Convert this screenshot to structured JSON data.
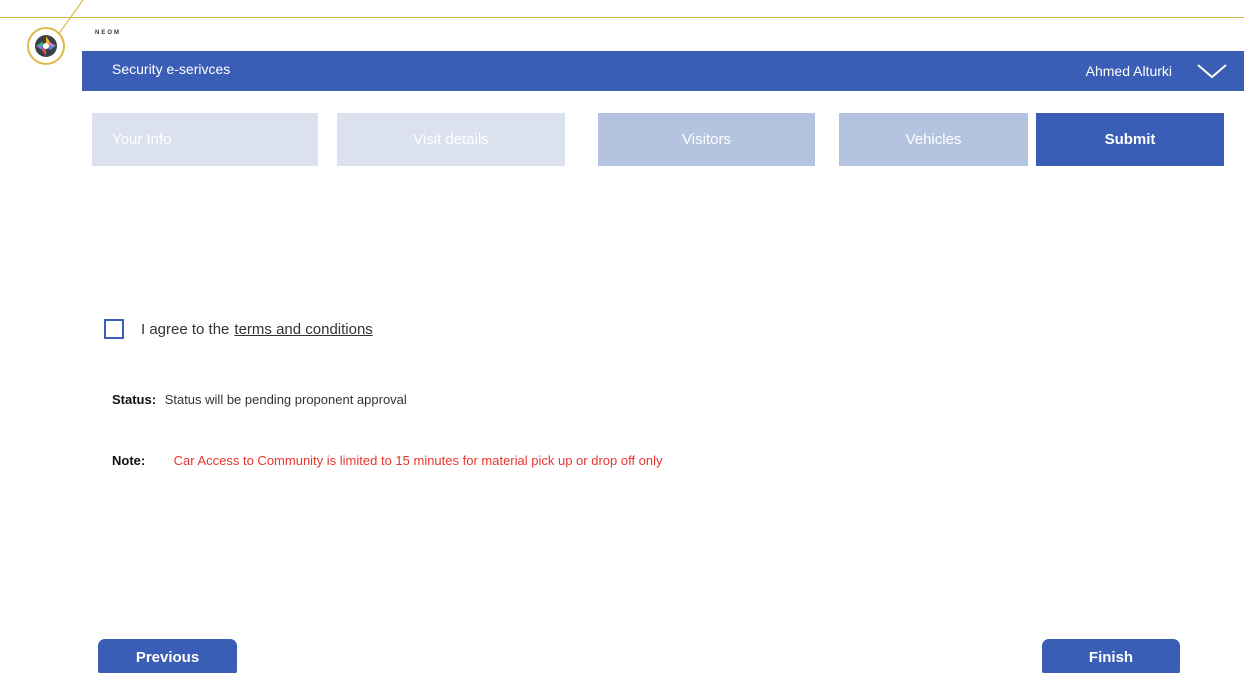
{
  "brand": {
    "name": "NEOM"
  },
  "header": {
    "title": "Security e-serivces",
    "user_name": "Ahmed Alturki",
    "color": "#3a5eb5"
  },
  "tabs": [
    {
      "label": "Your Info",
      "state": "completed"
    },
    {
      "label": "Visit details",
      "state": "completed"
    },
    {
      "label": "Visitors",
      "state": "completed"
    },
    {
      "label": "Vehicles",
      "state": "completed"
    },
    {
      "label": "Submit",
      "state": "active"
    }
  ],
  "agreement": {
    "prefix": "I agree to the",
    "link_text": "terms and conditions",
    "checked": false
  },
  "status": {
    "label": "Status:",
    "value": "Status will be pending proponent approval"
  },
  "note": {
    "label": "Note:",
    "value": "Car Access to Community is limited to 15 minutes for material pick up or drop off only",
    "color": "#e8362f"
  },
  "buttons": {
    "previous": "Previous",
    "finish": "Finish"
  },
  "icons": {
    "logo": "neom-logo-icon",
    "user_menu": "chevron-down-icon"
  }
}
